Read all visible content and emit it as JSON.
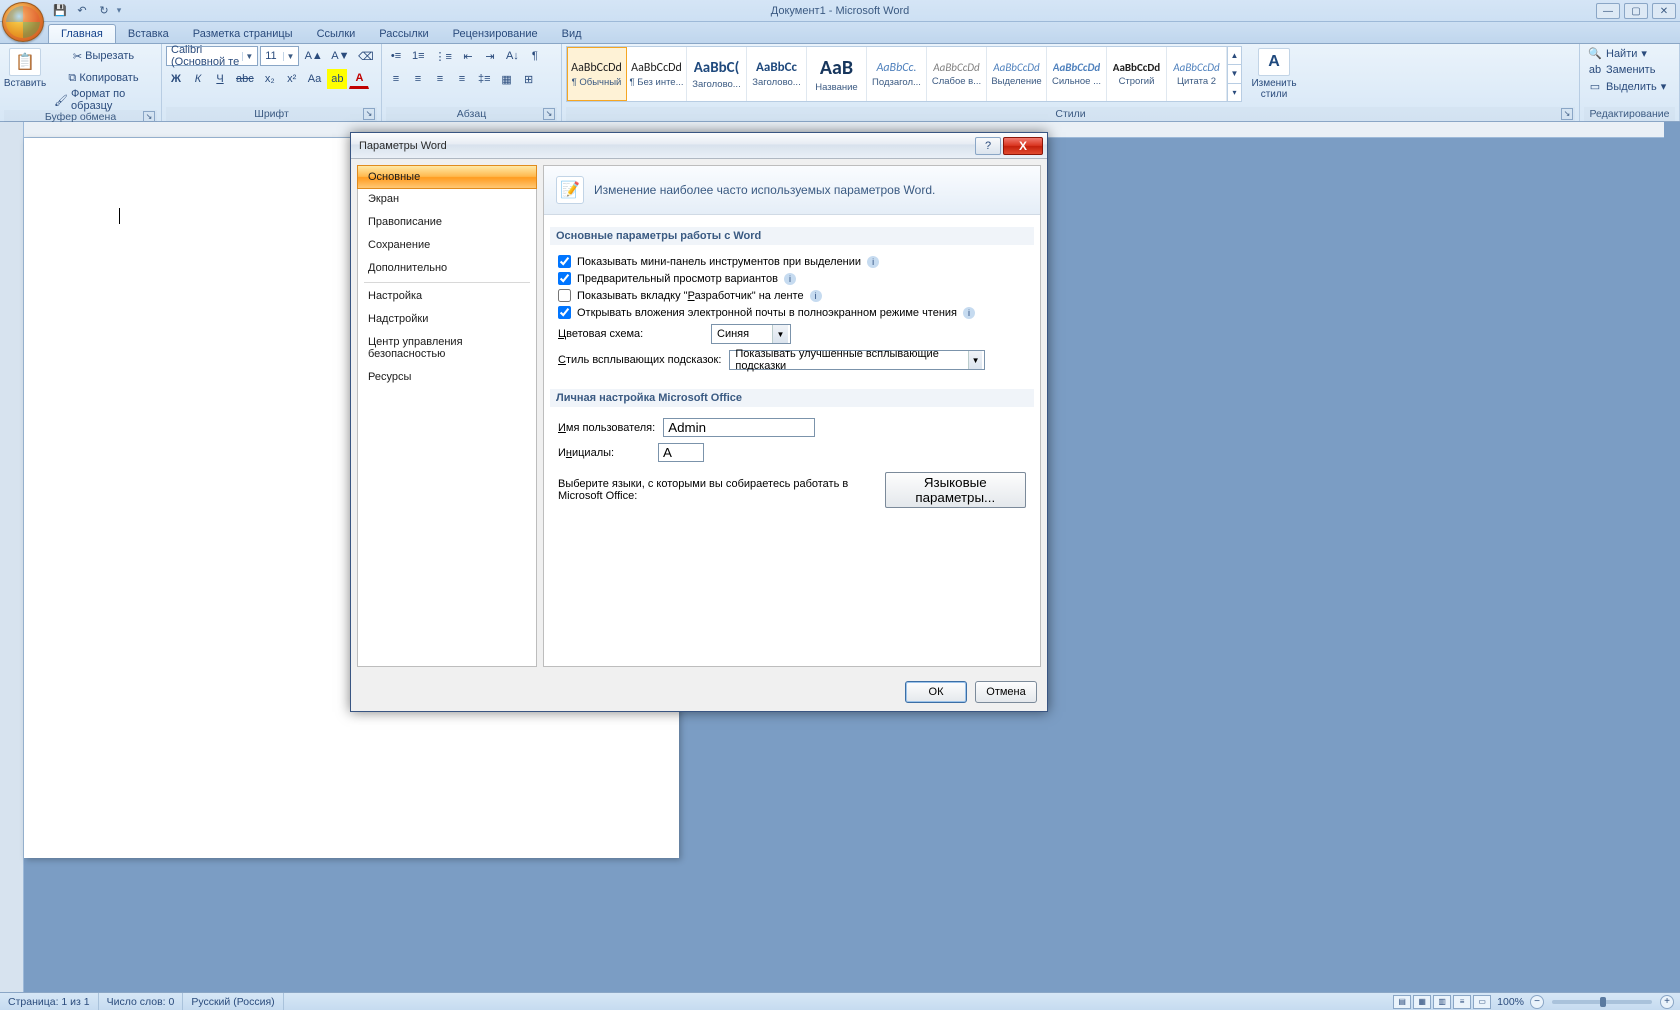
{
  "titlebar": {
    "title": "Документ1 - Microsoft Word",
    "qat": {
      "save": "💾",
      "undo": "↶",
      "redo": "↻",
      "more": "▾"
    },
    "win": {
      "min": "—",
      "max": "▢",
      "close": "✕"
    }
  },
  "tabs": [
    "Главная",
    "Вставка",
    "Разметка страницы",
    "Ссылки",
    "Рассылки",
    "Рецензирование",
    "Вид"
  ],
  "ribbon": {
    "clipboard": {
      "label": "Буфер обмена",
      "paste": "Вставить",
      "cut": "Вырезать",
      "copy": "Копировать",
      "format_painter": "Формат по образцу"
    },
    "font": {
      "label": "Шрифт",
      "name": "Calibri (Основной те",
      "size": "11",
      "buttons": {
        "bold": "Ж",
        "italic": "К",
        "underline": "Ч",
        "strike": "abc",
        "sub": "x₂",
        "sup": "x²",
        "case": "Aa",
        "clear": "⌫",
        "grow": "A▲",
        "shrink": "A▼",
        "highlight": "ab",
        "color": "A"
      }
    },
    "paragraph": {
      "label": "Абзац"
    },
    "styles_group": {
      "label": "Стили",
      "change": "Изменить стили",
      "items": [
        {
          "name": "¶ Обычный",
          "preview": "AaBbCcDd",
          "selected": true,
          "size": "12px",
          "color": "#222"
        },
        {
          "name": "¶ Без инте...",
          "preview": "AaBbCcDd",
          "size": "12px",
          "color": "#222"
        },
        {
          "name": "Заголово...",
          "preview": "AaBbC(",
          "size": "15px",
          "color": "#1f497d",
          "bold": true
        },
        {
          "name": "Заголово...",
          "preview": "AaBbCc",
          "size": "13px",
          "color": "#1f497d",
          "bold": true
        },
        {
          "name": "Название",
          "preview": "AaB",
          "size": "20px",
          "color": "#17365d",
          "bold": true
        },
        {
          "name": "Подзагол...",
          "preview": "AaBbCc.",
          "size": "12px",
          "color": "#4f81bd",
          "italic": true
        },
        {
          "name": "Слабое в...",
          "preview": "AaBbCcDd",
          "size": "11px",
          "color": "#808080",
          "italic": true
        },
        {
          "name": "Выделение",
          "preview": "AaBbCcDd",
          "size": "11px",
          "color": "#4f81bd",
          "italic": true
        },
        {
          "name": "Сильное ...",
          "preview": "AaBbCcDd",
          "size": "11px",
          "color": "#4f81bd",
          "italic": true,
          "bold": true
        },
        {
          "name": "Строгий",
          "preview": "AaBbCcDd",
          "size": "11px",
          "color": "#222",
          "bold": true
        },
        {
          "name": "Цитата 2",
          "preview": "AaBbCcDd",
          "size": "11px",
          "color": "#4f81bd",
          "italic": true
        }
      ]
    },
    "editing": {
      "label": "Редактирование",
      "find": "Найти",
      "replace": "Заменить",
      "select": "Выделить"
    }
  },
  "statusbar": {
    "page": "Страница: 1 из 1",
    "words": "Число слов: 0",
    "lang": "Русский (Россия)",
    "zoom": "100%"
  },
  "dialog": {
    "title": "Параметры Word",
    "nav": [
      {
        "label": "Основные",
        "selected": true
      },
      {
        "label": "Экран"
      },
      {
        "label": "Правописание"
      },
      {
        "label": "Сохранение"
      },
      {
        "label": "Дополнительно"
      },
      {
        "sep": true
      },
      {
        "label": "Настройка"
      },
      {
        "label": "Надстройки"
      },
      {
        "label": "Центр управления безопасностью"
      },
      {
        "label": "Ресурсы"
      }
    ],
    "header": "Изменение наиболее часто используемых параметров Word.",
    "section1_title": "Основные параметры работы с Word",
    "cb1": {
      "checked": true,
      "label": "Показывать мини-панель инструментов при выделении"
    },
    "cb2": {
      "checked": true,
      "label": "Предварительный просмотр вариантов"
    },
    "cb3": {
      "checked": false,
      "label": "Показывать вкладку \"Разработчик\" на ленте",
      "u": "Р"
    },
    "cb4": {
      "checked": true,
      "label": "Открывать вложения электронной почты в полноэкранном режиме чтения"
    },
    "color_scheme": {
      "label": "Цветовая схема:",
      "u": "Ц",
      "value": "Синяя"
    },
    "tooltips": {
      "label": "Стиль всплывающих подсказок:",
      "u": "С",
      "value": "Показывать улучшенные всплывающие подсказки"
    },
    "section2_title": "Личная настройка Microsoft Office",
    "username": {
      "label": "Имя пользователя:",
      "u": "И",
      "value": "Admin"
    },
    "initials": {
      "label": "Инициалы:",
      "u": "И",
      "value": "A"
    },
    "lang_prompt": "Выберите языки, с которыми вы собираетесь работать в Microsoft Office:",
    "lang_btn": "Языковые параметры...",
    "ok": "ОК",
    "cancel": "Отмена"
  }
}
